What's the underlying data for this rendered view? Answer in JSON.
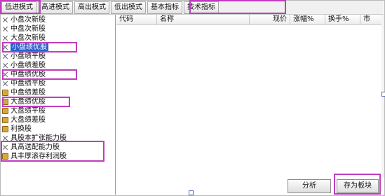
{
  "tabs": [
    "低进模式",
    "高进模式",
    "高出模式",
    "低出模式",
    "基本指标",
    "技术指标"
  ],
  "tree_items": [
    {
      "label": "小盘次新股",
      "icon": "x-icon"
    },
    {
      "label": "中盘次新股",
      "icon": "x-icon"
    },
    {
      "label": "大盘次新股",
      "icon": "x-icon"
    },
    {
      "label": "小盘绩优股",
      "icon": "x-icon",
      "selected": true
    },
    {
      "label": "小盘绩平股",
      "icon": "x-icon"
    },
    {
      "label": "小盘绩差股",
      "icon": "x-icon"
    },
    {
      "label": "中盘绩优股",
      "icon": "x-icon"
    },
    {
      "label": "中盘绩平股",
      "icon": "x-icon"
    },
    {
      "label": "中盘绩差股",
      "icon": "folder-icon"
    },
    {
      "label": "大盘绩优股",
      "icon": "folder-icon"
    },
    {
      "label": "大盘绩平股",
      "icon": "folder-icon"
    },
    {
      "label": "大盘绩差股",
      "icon": "folder-icon"
    },
    {
      "label": "利换股",
      "icon": "folder-icon"
    },
    {
      "label": "具股本扩张能力股",
      "icon": "x-icon"
    },
    {
      "label": "具高送配能力股",
      "icon": "x-icon"
    },
    {
      "label": "具丰厚滚存利润股",
      "icon": "folder-icon"
    }
  ],
  "table": {
    "columns": [
      "代码",
      "名称",
      "现价",
      "涨幅%",
      "换手%",
      "市"
    ]
  },
  "buttons": {
    "analyze": "分析",
    "save_block": "存为板块"
  },
  "colors": {
    "highlight": "#c03cc0",
    "selection": "#2f5ec8"
  }
}
